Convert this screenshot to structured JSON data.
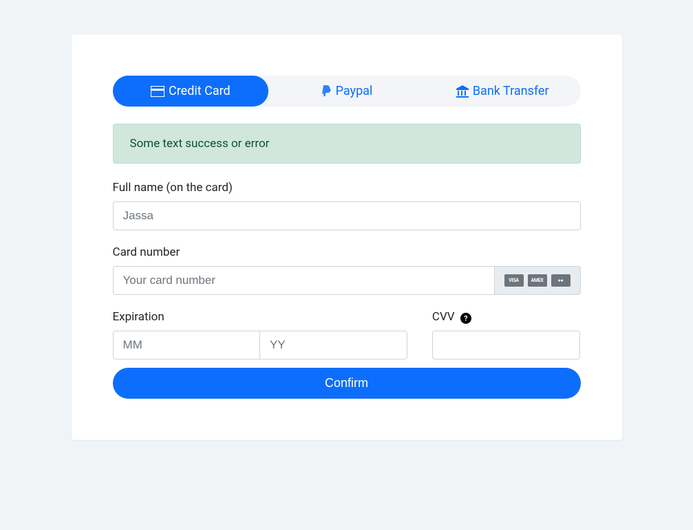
{
  "tabs": {
    "credit_card": "Credit Card",
    "paypal": "Paypal",
    "bank_transfer": "Bank Transfer"
  },
  "alert": {
    "message": "Some text success or error"
  },
  "form": {
    "full_name": {
      "label": "Full name (on the card)",
      "placeholder": "Jassa",
      "value": ""
    },
    "card_number": {
      "label": "Card number",
      "placeholder": "Your card number",
      "value": ""
    },
    "expiration": {
      "label": "Expiration",
      "month_placeholder": "MM",
      "year_placeholder": "YY",
      "month_value": "",
      "year_value": ""
    },
    "cvv": {
      "label": "CVV",
      "value": ""
    },
    "card_brands": {
      "visa": "VISA",
      "amex": "AMEX",
      "mc": "●●"
    },
    "confirm_button": "Confirm"
  }
}
